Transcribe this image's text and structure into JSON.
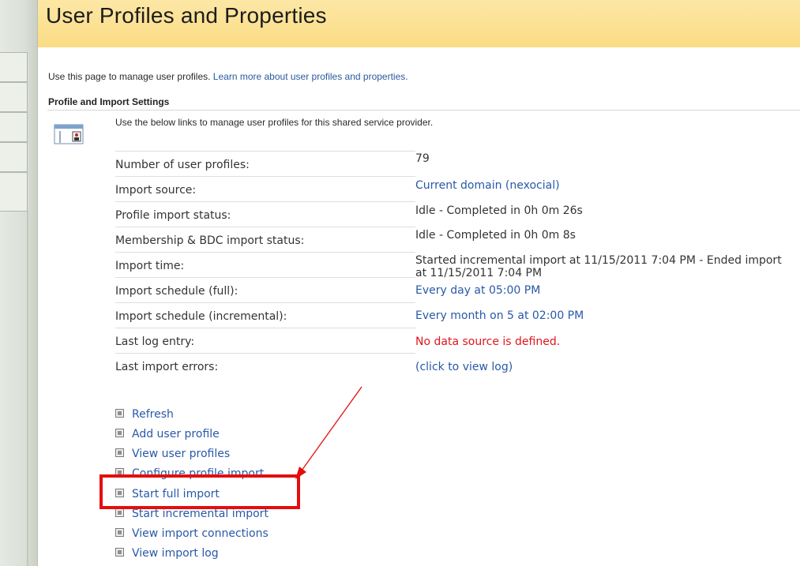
{
  "page": {
    "title": "User Profiles and Properties",
    "intro_text": "Use this page to manage user profiles.",
    "intro_link": "Learn more about user profiles and properties."
  },
  "section": {
    "title": "Profile and Import Settings",
    "description": "Use the below links to manage user profiles for this shared service provider.",
    "icon": "profile-settings-icon"
  },
  "properties": [
    {
      "label": "Number of user profiles:",
      "value": "79",
      "kind": "text"
    },
    {
      "label": "Import source:",
      "value": "Current domain (nexocial)",
      "kind": "link"
    },
    {
      "label": "Profile import status:",
      "value": "Idle - Completed in 0h 0m 26s",
      "kind": "text"
    },
    {
      "label": "Membership & BDC import status:",
      "value": "Idle - Completed in 0h 0m 8s",
      "kind": "text"
    },
    {
      "label": "Import time:",
      "value": "Started incremental import at 11/15/2011 7:04 PM - Ended import at 11/15/2011 7:04 PM",
      "kind": "text"
    },
    {
      "label": "Import schedule (full):",
      "value": "Every day at 05:00 PM",
      "kind": "link"
    },
    {
      "label": "Import schedule (incremental):",
      "value": "Every month on 5 at 02:00 PM",
      "kind": "link"
    },
    {
      "label": "Last log entry:",
      "value": "No data source is defined.",
      "kind": "error"
    },
    {
      "label": "Last import errors:",
      "value": "(click to view log)",
      "kind": "link"
    }
  ],
  "actions": [
    "Refresh",
    "Add user profile",
    "View user profiles",
    "Configure profile import",
    "Start full import",
    "Start incremental import",
    "View import connections",
    "View import log"
  ],
  "colors": {
    "title_bar": "#fbdc84",
    "link": "#2859a8",
    "error": "#e0141e",
    "highlight": "#e40e0e"
  }
}
